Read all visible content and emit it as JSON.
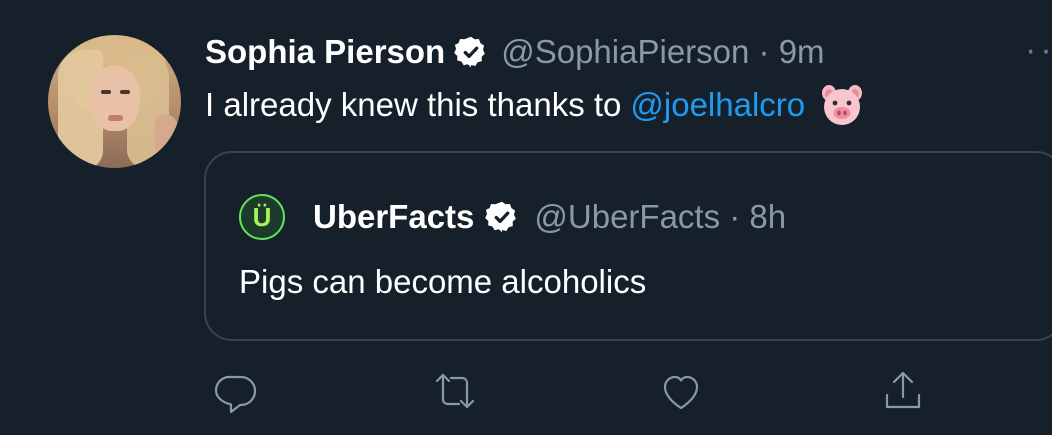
{
  "tweet": {
    "author_name": "Sophia Pierson",
    "author_handle_time": "@SophiaPierson · 9m",
    "text_before": "I already knew this thanks to",
    "mention": "@joelhalcro",
    "emoji": "pig-face-emoji",
    "more_icon": "more-dots-icon"
  },
  "quote": {
    "author_name": "UberFacts",
    "author_handle_time": "@UberFacts · 8h",
    "avatar_letter": "Ü",
    "text": "Pigs can become alcoholics"
  },
  "actions": [
    {
      "icon": "reply-icon"
    },
    {
      "icon": "retweet-icon"
    },
    {
      "icon": "like-icon"
    },
    {
      "icon": "share-icon"
    }
  ],
  "colors": {
    "background": "#15202b",
    "link": "#1d9bf0",
    "muted": "#8b98a5",
    "border": "#38444d",
    "verified": "#ffffff"
  }
}
